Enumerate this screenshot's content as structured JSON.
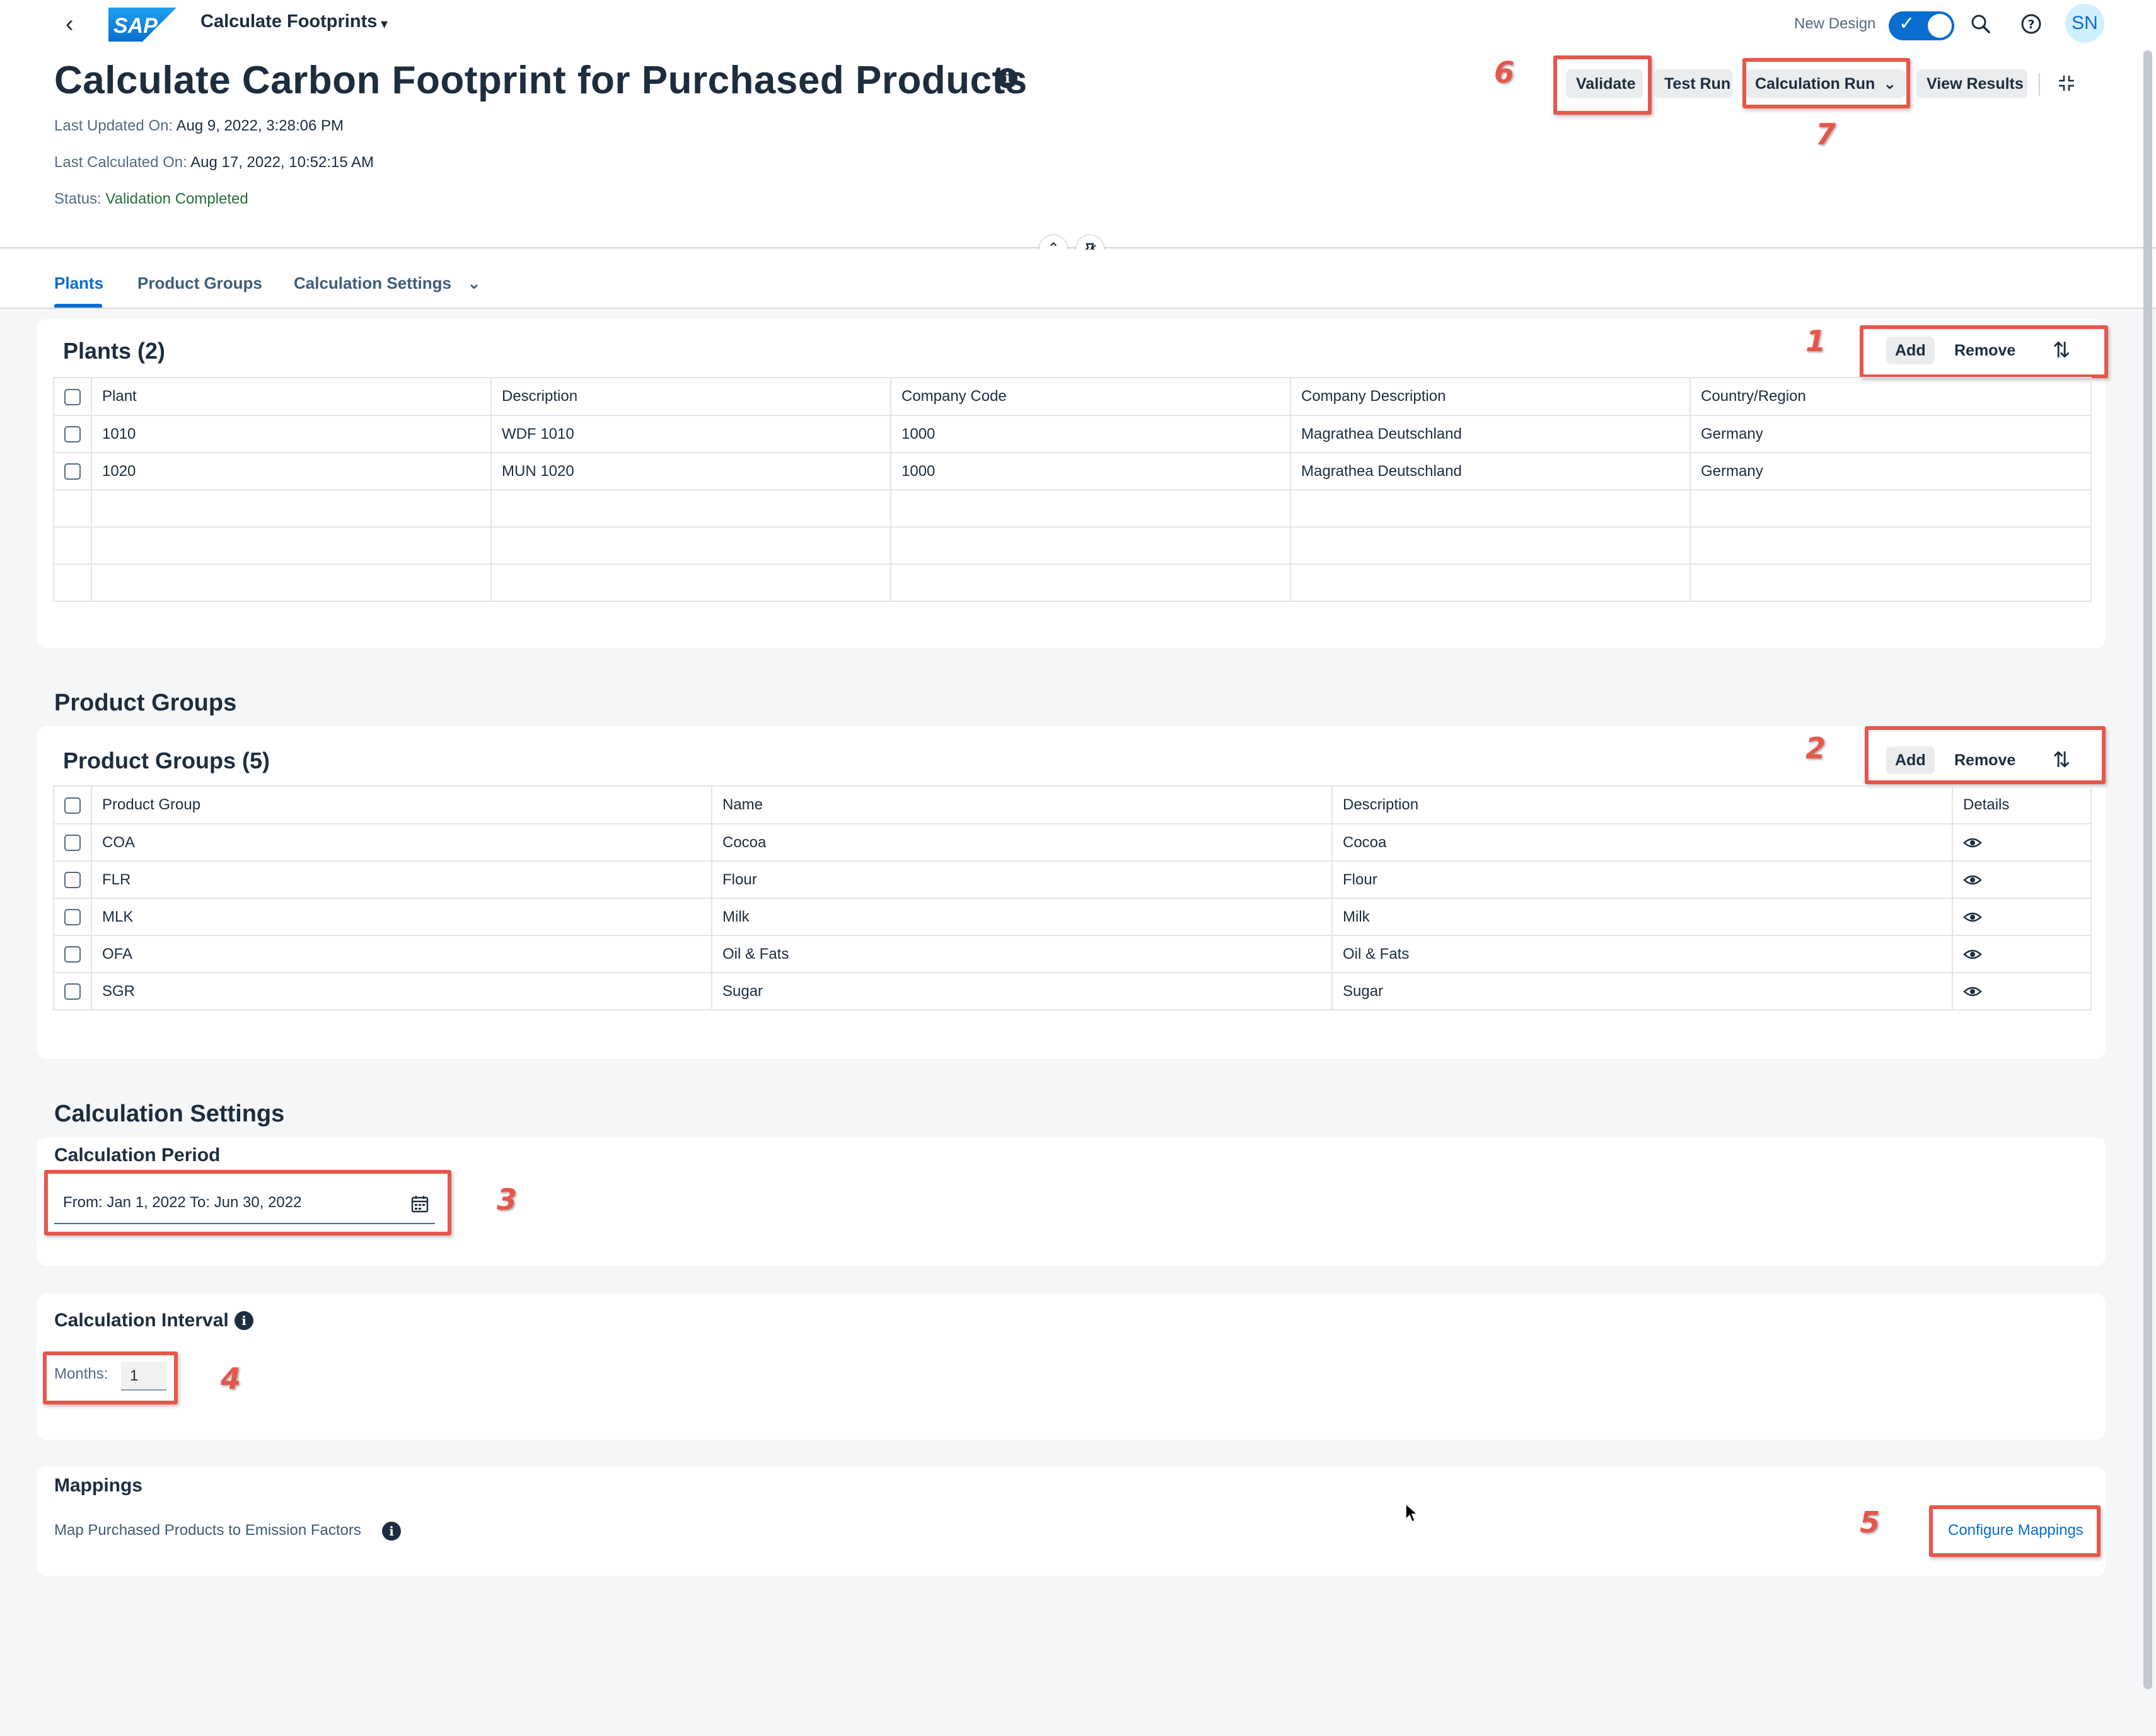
{
  "shell": {
    "app_title": "Calculate Footprints",
    "logo_text": "SAP",
    "new_design_label": "New Design",
    "avatar_initials": "SN"
  },
  "header": {
    "title": "Calculate Carbon Footprint for Purchased Products",
    "last_updated_label": "Last Updated On:",
    "last_updated_value": "Aug 9, 2022, 3:28:06 PM",
    "last_calculated_label": "Last Calculated On:",
    "last_calculated_value": "Aug 17, 2022, 10:52:15 AM",
    "status_label": "Status:",
    "status_value": "Validation Completed",
    "actions": {
      "validate": "Validate",
      "test_run": "Test Run",
      "calculation_run": "Calculation Run",
      "view_results": "View Results"
    }
  },
  "tabs": [
    {
      "label": "Plants"
    },
    {
      "label": "Product Groups"
    },
    {
      "label": "Calculation Settings"
    }
  ],
  "plants": {
    "title": "Plants (2)",
    "add": "Add",
    "remove": "Remove",
    "columns": [
      "Plant",
      "Description",
      "Company Code",
      "Company Description",
      "Country/Region"
    ],
    "rows": [
      [
        "1010",
        "WDF 1010",
        "1000",
        "Magrathea Deutschland",
        "Germany"
      ],
      [
        "1020",
        "MUN 1020",
        "1000",
        "Magrathea Deutschland",
        "Germany"
      ]
    ]
  },
  "product_groups": {
    "section_title": "Product Groups",
    "title": "Product Groups (5)",
    "add": "Add",
    "remove": "Remove",
    "columns": [
      "Product Group",
      "Name",
      "Description",
      "Details"
    ],
    "rows": [
      [
        "COA",
        "Cocoa",
        "Cocoa"
      ],
      [
        "FLR",
        "Flour",
        "Flour"
      ],
      [
        "MLK",
        "Milk",
        "Milk"
      ],
      [
        "OFA",
        "Oil & Fats",
        "Oil & Fats"
      ],
      [
        "SGR",
        "Sugar",
        "Sugar"
      ]
    ]
  },
  "calculation_settings": {
    "section_title": "Calculation Settings",
    "period_title": "Calculation Period",
    "period_value": "From: Jan 1, 2022 To: Jun 30, 2022",
    "interval_title": "Calculation Interval",
    "months_label": "Months:",
    "months_value": "1",
    "mappings_title": "Mappings",
    "mappings_text": "Map Purchased Products to Emission Factors",
    "configure_link": "Configure Mappings"
  },
  "callouts": [
    "1",
    "2",
    "3",
    "4",
    "5",
    "6",
    "7"
  ],
  "colors": {
    "accent": "#0a6ed1",
    "status_success": "#256f3a",
    "annotation": "#e8564a"
  }
}
